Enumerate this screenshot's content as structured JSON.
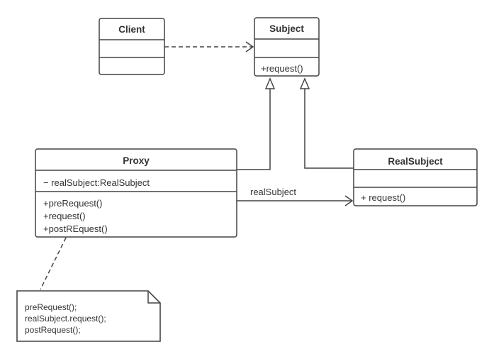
{
  "classes": {
    "client": {
      "name": "Client",
      "attributes": [],
      "methods": []
    },
    "subject": {
      "name": "Subject",
      "attributes": [],
      "methods": [
        "+request()"
      ]
    },
    "proxy": {
      "name": "Proxy",
      "attributes": [
        "− realSubject:RealSubject"
      ],
      "methods": [
        "+preRequest()",
        "+request()",
        "+postREquest()"
      ]
    },
    "real_subject": {
      "name": "RealSubject",
      "attributes": [],
      "methods": [
        "+ request()"
      ]
    }
  },
  "relations": {
    "association_label": "realSubject"
  },
  "note": {
    "lines": [
      "preRequest();",
      "realSubject.request();",
      "postRequest();"
    ]
  }
}
